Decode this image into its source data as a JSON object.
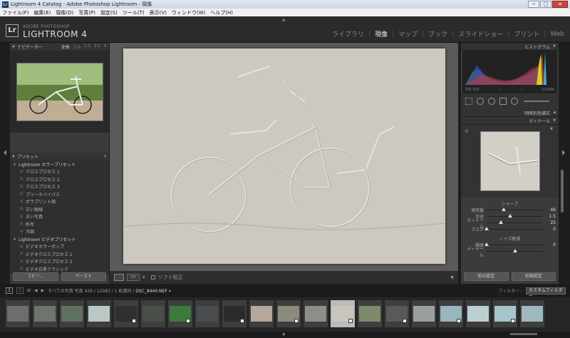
{
  "window": {
    "title": "Lightroom 4 Catalog - Adobe Photoshop Lightroom - 現像",
    "app_icon": "Lr"
  },
  "menu": [
    "ファイル(F)",
    "編集(E)",
    "現像(D)",
    "写真(P)",
    "設定(S)",
    "ツール(T)",
    "表示(V)",
    "ウィンドウ(W)",
    "ヘルプ(H)"
  ],
  "identity": {
    "logo": "Lr",
    "sub": "ADOBE PHOTOSHOP",
    "name": "LIGHTROOM 4"
  },
  "modules": [
    "ライブラリ",
    "現像",
    "マップ",
    "ブック",
    "スライドショー",
    "プリント",
    "Web"
  ],
  "active_module": "現像",
  "navigator": {
    "title": "ナビゲーター",
    "options": [
      "全体",
      "フル",
      "1:1",
      "3:1"
    ],
    "active_option": "全体"
  },
  "presets": {
    "title": "プリセット",
    "add_icon": "+",
    "items": [
      {
        "label": "Lightroom カラープリセット",
        "folder": true
      },
      {
        "label": "クロスプロセス 1",
        "folder": false
      },
      {
        "label": "クロスプロセス 2",
        "folder": false
      },
      {
        "label": "クロスプロセス 3",
        "folder": false
      },
      {
        "label": "ブリーチバイパス",
        "folder": false
      },
      {
        "label": "ポラプリント調",
        "folder": false
      },
      {
        "label": "古い極線",
        "folder": false
      },
      {
        "label": "古い写真",
        "folder": false
      },
      {
        "label": "昨年",
        "folder": false
      },
      {
        "label": "冷調",
        "folder": false
      },
      {
        "label": "Lightroom ビデオプリセット",
        "folder": true
      },
      {
        "label": "ビデオカラーポップ",
        "folder": false
      },
      {
        "label": "ビデオクロスプロセス 1",
        "folder": false
      },
      {
        "label": "ビデオクロスプロセス 2",
        "folder": false
      },
      {
        "label": "ビデオ白黒クラシック",
        "folder": false
      }
    ]
  },
  "left_buttons": {
    "copy": "コピー...",
    "paste": "ペースト"
  },
  "toolbar": {
    "soft_proof": "ソフト校正"
  },
  "histogram": {
    "title": "ヒストグラム",
    "iso": "ISO 320",
    "dash1": "−",
    "dash2": "−",
    "shutter": "1/2000"
  },
  "panels": {
    "split_toning": "明暗別色補正",
    "detail": "ディテール"
  },
  "detail": {
    "sharpen_label": "シャープ",
    "sliders": [
      {
        "label": "適用量",
        "value": "46",
        "pos": 0.31
      },
      {
        "label": "半径",
        "value": "1.5",
        "pos": 0.42
      },
      {
        "label": "ディテール",
        "value": "25",
        "pos": 0.25
      },
      {
        "label": "マスク",
        "value": "0",
        "pos": 0.0
      }
    ],
    "noise_label": "ノイズ軽減",
    "noise_sliders": [
      {
        "label": "輝度",
        "value": "0",
        "pos": 0.0
      },
      {
        "label": "ディテール",
        "value": "",
        "pos": 0.5
      }
    ]
  },
  "right_buttons": {
    "previous": "前の設定",
    "reset": "初期設定"
  },
  "filmstrip": {
    "page1": "1",
    "page2": "2",
    "path_prefix": "すべての写真",
    "count": "写真 439 / 12983 / 1 枚選択 /",
    "filename": "DSC_8440.NEF",
    "filename_suffix": "▾",
    "filter_label": "フィルター :",
    "filter_value": "カスタムフィルター",
    "thumb_colors": [
      "#6b6e6a",
      "#6f746e",
      "#5f7260",
      "#b9c8c4",
      "#2f3030",
      "#4a4f4a",
      "#3d7a3a",
      "#4a4d4f",
      "#2a2c2a",
      "#b7a79a",
      "#8d8a7e",
      "#8c8f86",
      "#c9c6bd",
      "#7e8a6a",
      "#5b5957",
      "#9aa0a0",
      "#97b6bd",
      "#bcd0d4",
      "#a8c4cb",
      "#9fb8c0"
    ]
  }
}
